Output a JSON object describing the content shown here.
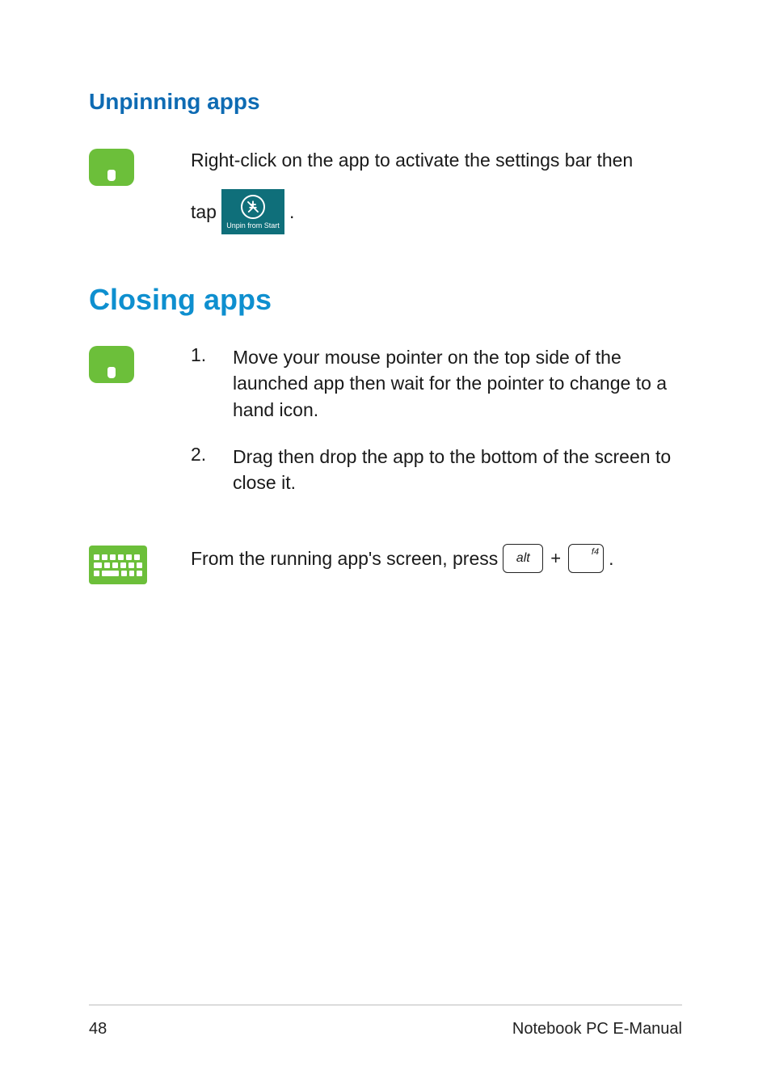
{
  "sections": {
    "unpinning": {
      "heading": "Unpinning apps",
      "mouse": {
        "line1": "Right-click on the app to activate the settings bar then",
        "tap_prefix": "tap",
        "tap_suffix": ".",
        "tile_label": "Unpin from Start"
      }
    },
    "closing": {
      "heading": "Closing apps",
      "mouse_steps": [
        {
          "n": "1.",
          "text": "Move your mouse pointer on the top side of the launched app then wait for the pointer to change to a hand icon."
        },
        {
          "n": "2.",
          "text": "Drag then drop the app to the bottom of the screen to close it."
        }
      ],
      "keyboard": {
        "prefix": "From the running app's screen, press",
        "key1": "alt",
        "plus": "+",
        "key2_sup": "f4",
        "suffix": "."
      }
    }
  },
  "footer": {
    "page_number": "48",
    "doc_title": "Notebook PC E-Manual"
  }
}
